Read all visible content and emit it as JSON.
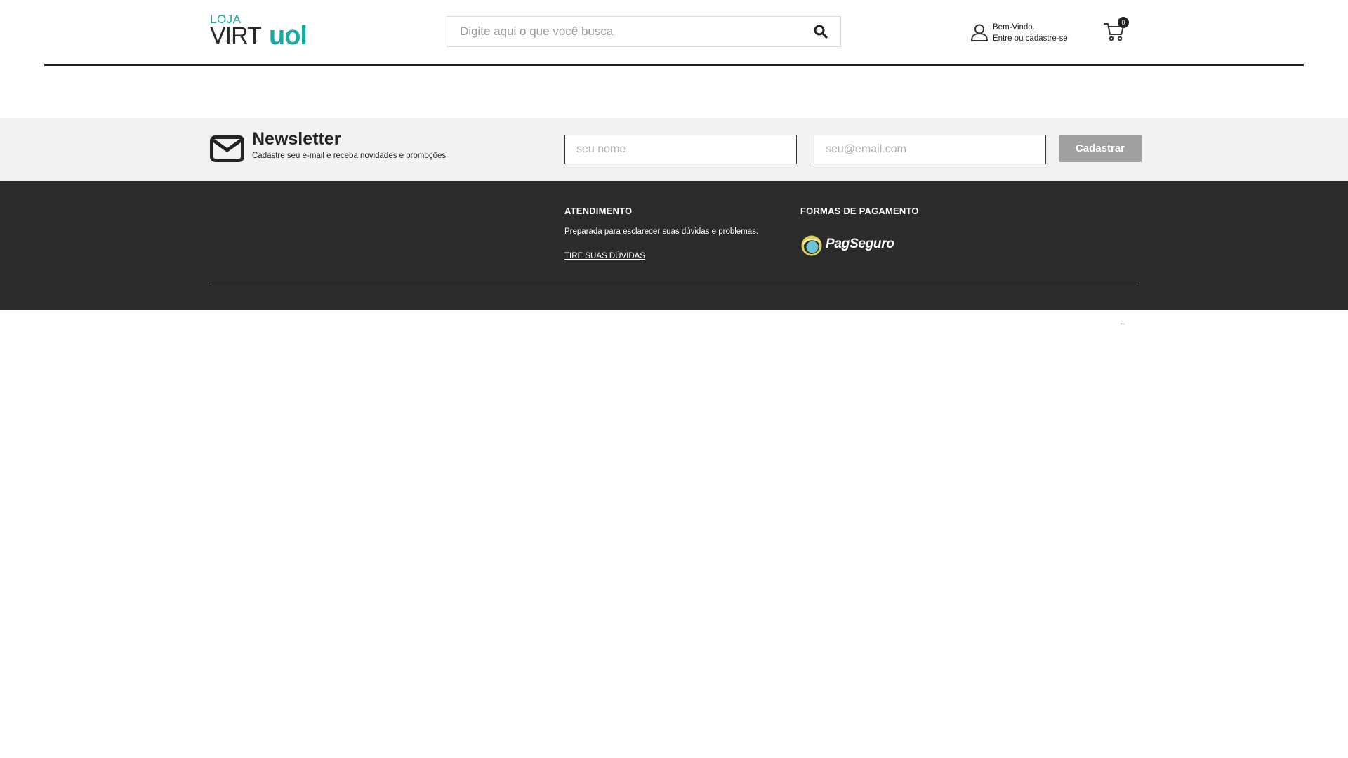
{
  "header": {
    "logo": {
      "top": "LOJA",
      "middle": "VIRT",
      "brand": "uol"
    },
    "search": {
      "placeholder": "Digite aqui o que você busca",
      "value": ""
    },
    "account": {
      "line1": "Bem-Vindo.",
      "line2": "Entre ou cadastre-se"
    },
    "cart": {
      "count": "0"
    }
  },
  "newsletter": {
    "title": "Newsletter",
    "subtitle": "Cadastre seu e-mail e receba novidades e promoções",
    "name_placeholder": "seu nome",
    "email_placeholder": "seu@email.com",
    "submit_label": "Cadastrar"
  },
  "footer": {
    "atendimento": {
      "heading": "ATENDIMENTO",
      "text": "Preparada para esclarecer suas dúvidas e problemas.",
      "link": "TIRE SUAS DÚVIDAS"
    },
    "pagamento": {
      "heading": "FORMAS DE PAGAMENTO",
      "provider": "PagSeguro"
    }
  },
  "colors": {
    "brand_teal": "#1aa9a0",
    "footer_bg": "#2b2b2b",
    "newsletter_bg": "#f2f2f2",
    "button_gray": "#a0a0a0"
  },
  "icons": [
    "search-icon",
    "user-icon",
    "cart-icon",
    "envelope-icon",
    "pagseguro-logo",
    "arrow-left-icon"
  ]
}
